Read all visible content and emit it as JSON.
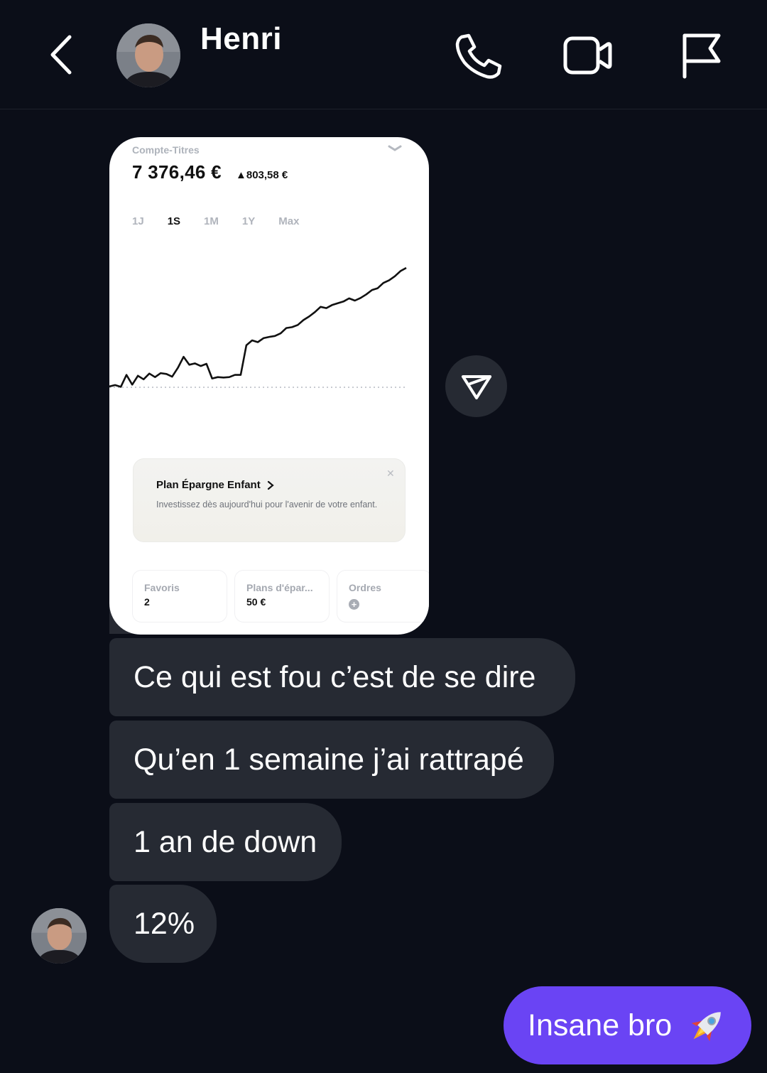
{
  "header": {
    "contact_name": "Henri"
  },
  "image_message": {
    "account_title": "Compte-Titres",
    "balance": "7 376,46 €",
    "delta": "▲803,58 €",
    "periods": [
      "1J",
      "1S",
      "1M",
      "1Y",
      "Max"
    ],
    "active_period": "1S",
    "promo": {
      "title": "Plan Épargne Enfant",
      "text": "Investissez dès aujourd'hui pour l'avenir de votre enfant."
    },
    "tiles": [
      {
        "label": "Favoris",
        "value": "2"
      },
      {
        "label": "Plans d'épar...",
        "value": "50 €"
      },
      {
        "label": "Ordres",
        "value": ""
      }
    ]
  },
  "messages": [
    {
      "text": "Ce qui est fou c’est de se dire"
    },
    {
      "text": "Qu’en 1 semaine j’ai rattrapé"
    },
    {
      "text": "1 an de down"
    },
    {
      "text": "12%"
    }
  ],
  "outgoing": {
    "text": "Insane bro"
  },
  "chart_data": {
    "type": "line",
    "values": [
      0.2,
      0.5,
      0.1,
      2.8,
      0.6,
      2.6,
      1.8,
      3.1,
      2.3,
      3.2,
      3.0,
      2.4,
      4.4,
      6.9,
      5.1,
      5.4,
      4.8,
      5.3,
      2.0,
      2.3,
      2.2,
      2.3,
      2.8,
      2.8,
      9.5,
      10.6,
      10.2,
      11.1,
      11.4,
      11.6,
      12.2,
      13.4,
      13.6,
      14.1,
      15.2,
      16.0,
      17.0,
      18.2,
      17.9,
      18.6,
      19.0,
      19.4,
      20.1,
      19.6,
      20.2,
      21.0,
      22.0,
      22.4,
      23.6,
      24.2,
      25.1,
      26.3,
      27.0
    ],
    "baseline": 0,
    "color": "#111111",
    "baseline_style": "dotted"
  },
  "colors": {
    "background": "#0b0e18",
    "incoming_bubble": "#262a33",
    "outgoing_bubble": "#6a44f4"
  }
}
